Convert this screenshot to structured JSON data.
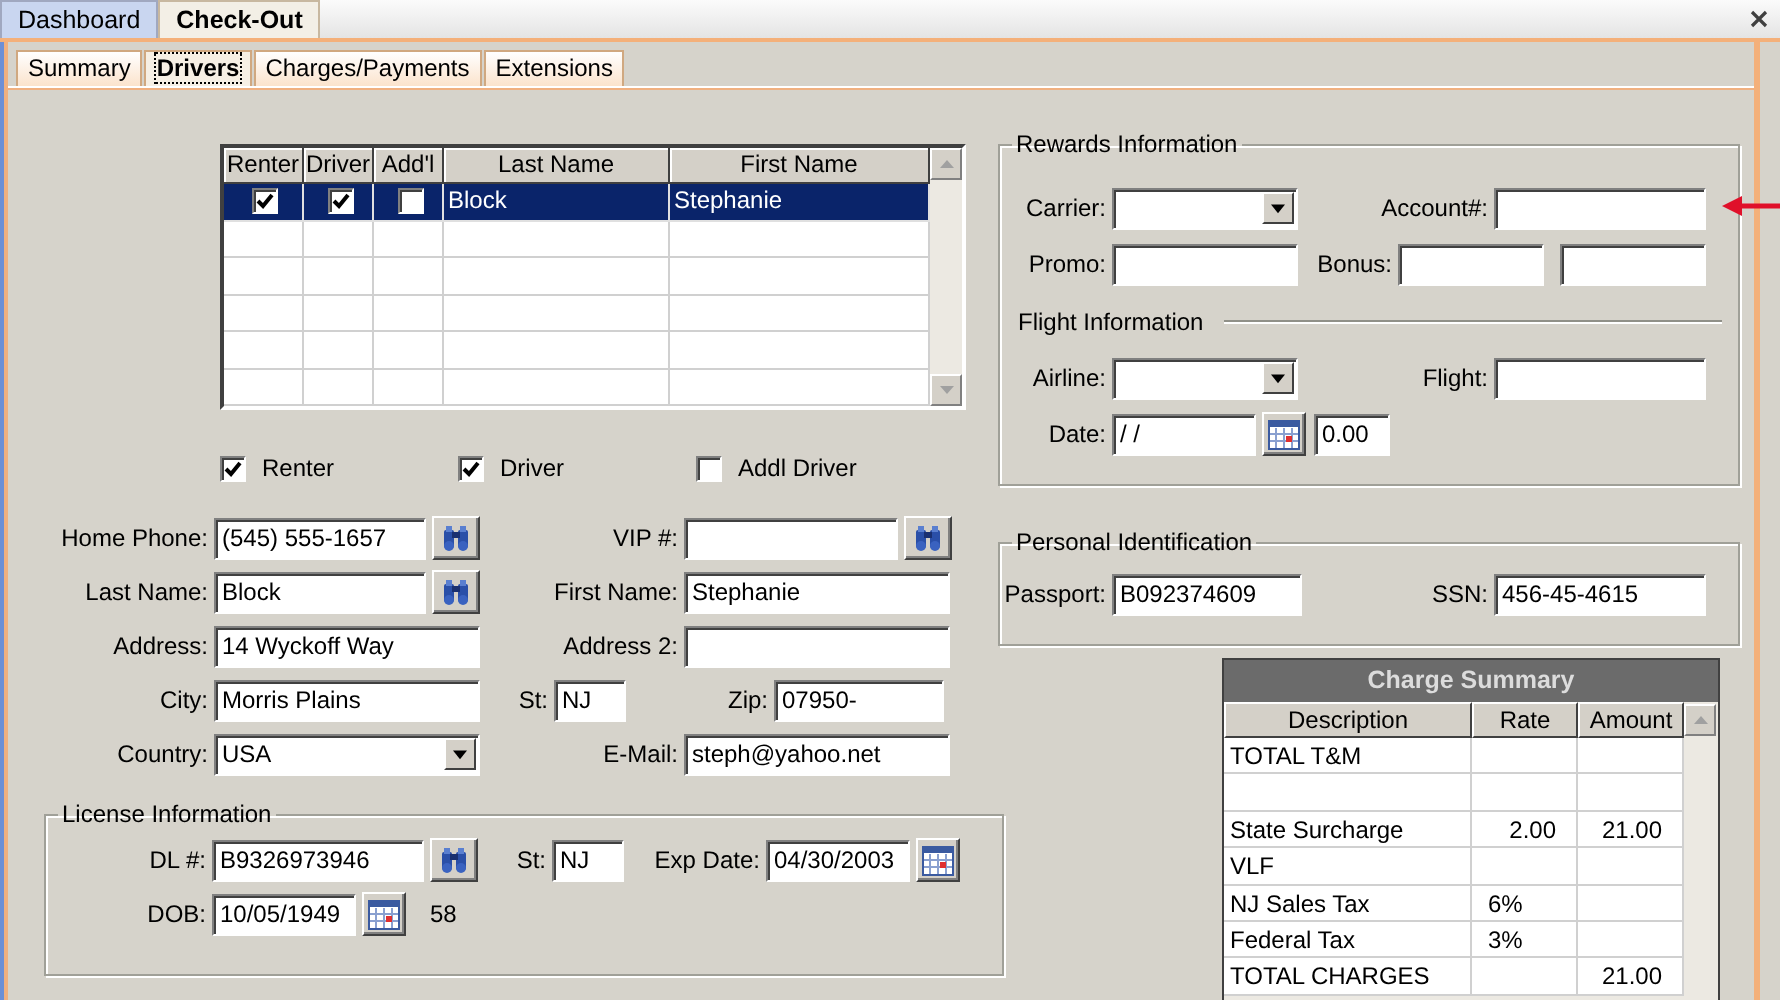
{
  "top_tabs": [
    {
      "label": "Dashboard",
      "selected": false
    },
    {
      "label": "Check-Out",
      "selected": true
    }
  ],
  "sub_tabs": [
    {
      "label": "Summary",
      "selected": false
    },
    {
      "label": "Drivers",
      "selected": true
    },
    {
      "label": "Charges/Payments",
      "selected": false
    },
    {
      "label": "Extensions",
      "selected": false
    }
  ],
  "drivers_grid": {
    "columns": [
      "Renter",
      "Driver",
      "Add'l",
      "Last Name",
      "First Name"
    ],
    "rows": [
      {
        "renter": true,
        "driver": true,
        "addl": false,
        "last_name": "Block",
        "first_name": "Stephanie",
        "selected": true
      }
    ]
  },
  "role_checks": [
    {
      "label": "Renter",
      "checked": true
    },
    {
      "label": "Driver",
      "checked": true
    },
    {
      "label": "Addl Driver",
      "checked": false
    }
  ],
  "driver_form": {
    "home_phone": {
      "label": "Home Phone:",
      "value": "(545) 555-1657"
    },
    "vip": {
      "label": "VIP #:"
    },
    "last_name": {
      "label": "Last Name:",
      "value": "Block"
    },
    "first_name": {
      "label": "First Name:",
      "value": "Stephanie"
    },
    "address": {
      "label": "Address:",
      "value": "14 Wyckoff Way"
    },
    "address2": {
      "label": "Address 2:"
    },
    "city": {
      "label": "City:",
      "value": "Morris Plains"
    },
    "state": {
      "label": "St:",
      "value": "NJ"
    },
    "zip": {
      "label": "Zip:",
      "value": "07950-"
    },
    "country": {
      "label": "Country:",
      "value": "USA"
    },
    "email": {
      "label": "E-Mail:",
      "value": "steph@yahoo.net"
    }
  },
  "license": {
    "title": "License Information",
    "dl": {
      "label": "DL #:",
      "value": "B9326973946"
    },
    "state": {
      "label": "St:",
      "value": "NJ"
    },
    "exp_date": {
      "label": "Exp Date:",
      "value": "04/30/2003"
    },
    "dob": {
      "label": "DOB:",
      "value": "10/05/1949"
    },
    "age": "58"
  },
  "rewards": {
    "title": "Rewards Information",
    "carrier": {
      "label": "Carrier:"
    },
    "account": {
      "label": "Account#:"
    },
    "promo": {
      "label": "Promo:"
    },
    "bonus": {
      "label": "Bonus:"
    },
    "flight_title": "Flight Information",
    "airline": {
      "label": "Airline:"
    },
    "flight": {
      "label": "Flight:"
    },
    "date": {
      "label": "Date:",
      "value": "/ /"
    },
    "amount": "0.00"
  },
  "personal_id": {
    "title": "Personal Identification",
    "passport": {
      "label": "Passport:",
      "value": "B092374609"
    },
    "ssn": {
      "label": "SSN:",
      "value": "456-45-4615"
    }
  },
  "charge_summary": {
    "title": "Charge Summary",
    "columns": [
      "Description",
      "Rate",
      "Amount"
    ],
    "rows": [
      {
        "description": "TOTAL T&M"
      },
      {},
      {
        "description": "State Surcharge",
        "rate": "2.00",
        "amount": "21.00"
      },
      {
        "description": "VLF"
      },
      {
        "description": "NJ Sales Tax",
        "rate": "6%"
      },
      {
        "description": "Federal Tax",
        "rate": "3%"
      },
      {
        "description": "TOTAL CHARGES",
        "amount": "21.00"
      }
    ]
  }
}
